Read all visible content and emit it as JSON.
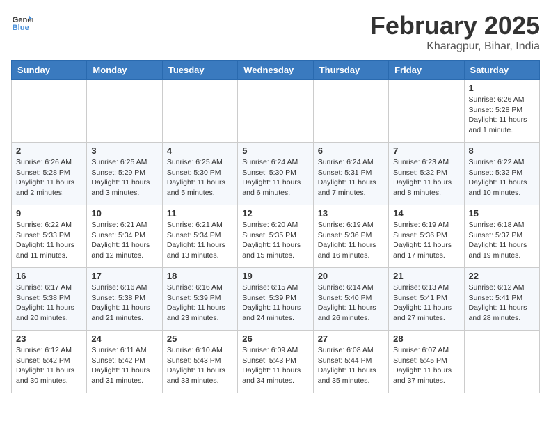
{
  "logo": {
    "line1": "General",
    "line2": "Blue"
  },
  "title": "February 2025",
  "location": "Kharagpur, Bihar, India",
  "weekdays": [
    "Sunday",
    "Monday",
    "Tuesday",
    "Wednesday",
    "Thursday",
    "Friday",
    "Saturday"
  ],
  "weeks": [
    [
      {
        "day": "",
        "info": ""
      },
      {
        "day": "",
        "info": ""
      },
      {
        "day": "",
        "info": ""
      },
      {
        "day": "",
        "info": ""
      },
      {
        "day": "",
        "info": ""
      },
      {
        "day": "",
        "info": ""
      },
      {
        "day": "1",
        "info": "Sunrise: 6:26 AM\nSunset: 5:28 PM\nDaylight: 11 hours and 1 minute."
      }
    ],
    [
      {
        "day": "2",
        "info": "Sunrise: 6:26 AM\nSunset: 5:28 PM\nDaylight: 11 hours and 2 minutes."
      },
      {
        "day": "3",
        "info": "Sunrise: 6:25 AM\nSunset: 5:29 PM\nDaylight: 11 hours and 3 minutes."
      },
      {
        "day": "4",
        "info": "Sunrise: 6:25 AM\nSunset: 5:30 PM\nDaylight: 11 hours and 5 minutes."
      },
      {
        "day": "5",
        "info": "Sunrise: 6:24 AM\nSunset: 5:30 PM\nDaylight: 11 hours and 6 minutes."
      },
      {
        "day": "6",
        "info": "Sunrise: 6:24 AM\nSunset: 5:31 PM\nDaylight: 11 hours and 7 minutes."
      },
      {
        "day": "7",
        "info": "Sunrise: 6:23 AM\nSunset: 5:32 PM\nDaylight: 11 hours and 8 minutes."
      },
      {
        "day": "8",
        "info": "Sunrise: 6:22 AM\nSunset: 5:32 PM\nDaylight: 11 hours and 10 minutes."
      }
    ],
    [
      {
        "day": "9",
        "info": "Sunrise: 6:22 AM\nSunset: 5:33 PM\nDaylight: 11 hours and 11 minutes."
      },
      {
        "day": "10",
        "info": "Sunrise: 6:21 AM\nSunset: 5:34 PM\nDaylight: 11 hours and 12 minutes."
      },
      {
        "day": "11",
        "info": "Sunrise: 6:21 AM\nSunset: 5:34 PM\nDaylight: 11 hours and 13 minutes."
      },
      {
        "day": "12",
        "info": "Sunrise: 6:20 AM\nSunset: 5:35 PM\nDaylight: 11 hours and 15 minutes."
      },
      {
        "day": "13",
        "info": "Sunrise: 6:19 AM\nSunset: 5:36 PM\nDaylight: 11 hours and 16 minutes."
      },
      {
        "day": "14",
        "info": "Sunrise: 6:19 AM\nSunset: 5:36 PM\nDaylight: 11 hours and 17 minutes."
      },
      {
        "day": "15",
        "info": "Sunrise: 6:18 AM\nSunset: 5:37 PM\nDaylight: 11 hours and 19 minutes."
      }
    ],
    [
      {
        "day": "16",
        "info": "Sunrise: 6:17 AM\nSunset: 5:38 PM\nDaylight: 11 hours and 20 minutes."
      },
      {
        "day": "17",
        "info": "Sunrise: 6:16 AM\nSunset: 5:38 PM\nDaylight: 11 hours and 21 minutes."
      },
      {
        "day": "18",
        "info": "Sunrise: 6:16 AM\nSunset: 5:39 PM\nDaylight: 11 hours and 23 minutes."
      },
      {
        "day": "19",
        "info": "Sunrise: 6:15 AM\nSunset: 5:39 PM\nDaylight: 11 hours and 24 minutes."
      },
      {
        "day": "20",
        "info": "Sunrise: 6:14 AM\nSunset: 5:40 PM\nDaylight: 11 hours and 26 minutes."
      },
      {
        "day": "21",
        "info": "Sunrise: 6:13 AM\nSunset: 5:41 PM\nDaylight: 11 hours and 27 minutes."
      },
      {
        "day": "22",
        "info": "Sunrise: 6:12 AM\nSunset: 5:41 PM\nDaylight: 11 hours and 28 minutes."
      }
    ],
    [
      {
        "day": "23",
        "info": "Sunrise: 6:12 AM\nSunset: 5:42 PM\nDaylight: 11 hours and 30 minutes."
      },
      {
        "day": "24",
        "info": "Sunrise: 6:11 AM\nSunset: 5:42 PM\nDaylight: 11 hours and 31 minutes."
      },
      {
        "day": "25",
        "info": "Sunrise: 6:10 AM\nSunset: 5:43 PM\nDaylight: 11 hours and 33 minutes."
      },
      {
        "day": "26",
        "info": "Sunrise: 6:09 AM\nSunset: 5:43 PM\nDaylight: 11 hours and 34 minutes."
      },
      {
        "day": "27",
        "info": "Sunrise: 6:08 AM\nSunset: 5:44 PM\nDaylight: 11 hours and 35 minutes."
      },
      {
        "day": "28",
        "info": "Sunrise: 6:07 AM\nSunset: 5:45 PM\nDaylight: 11 hours and 37 minutes."
      },
      {
        "day": "",
        "info": ""
      }
    ]
  ]
}
